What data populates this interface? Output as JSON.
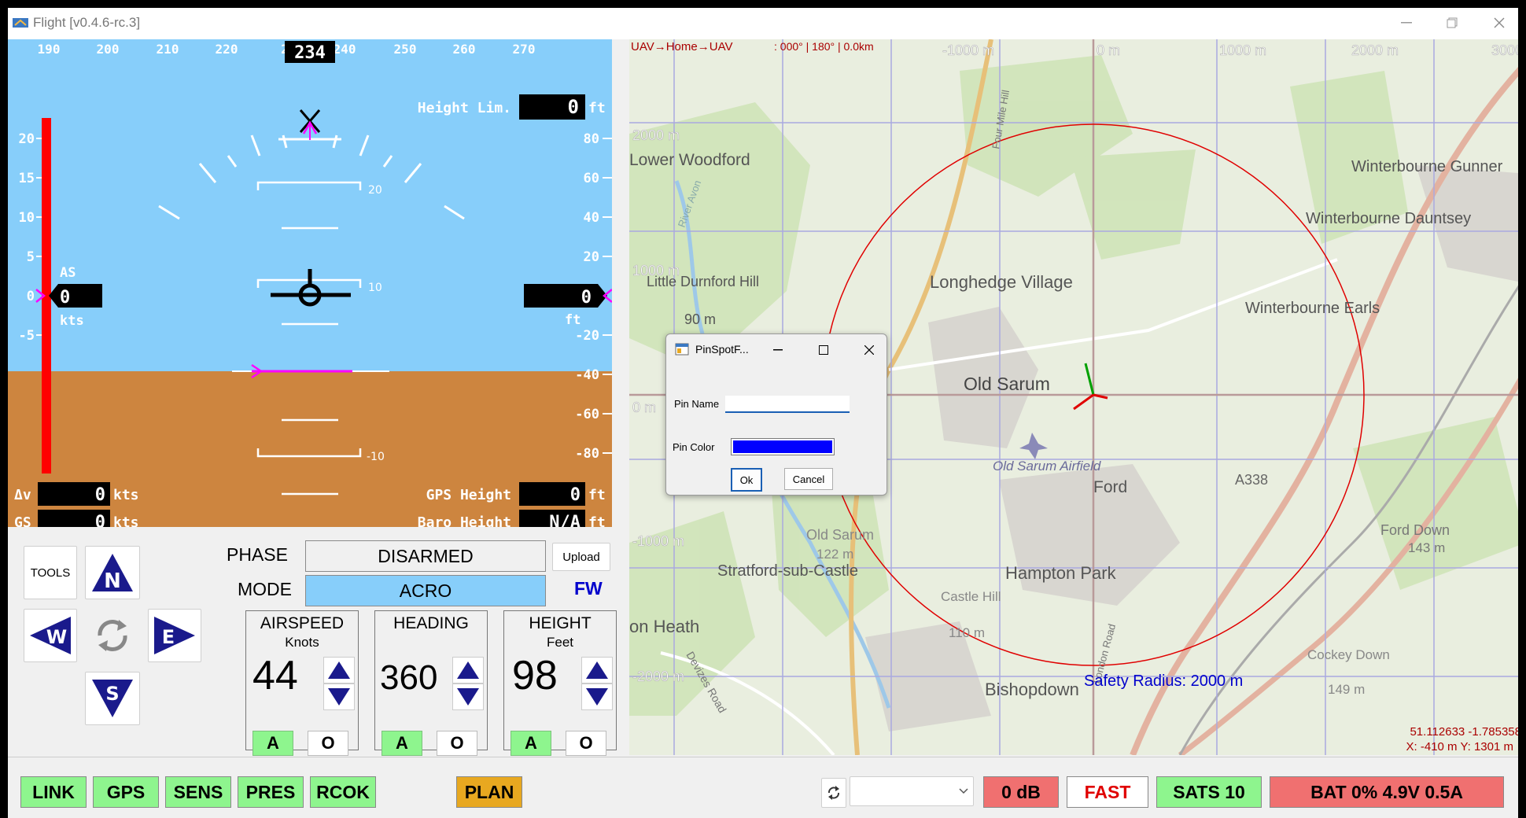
{
  "window": {
    "title": "Flight [v0.4.6-rc.3]"
  },
  "hud": {
    "heading_ticks": [
      "190",
      "200",
      "210",
      "220",
      "2",
      "240",
      "250",
      "260",
      "270"
    ],
    "heading_value": "234",
    "airspeed_ticks": [
      "20",
      "15",
      "10",
      "5",
      "0",
      "-5"
    ],
    "height_ticks": [
      "80",
      "60",
      "40",
      "20",
      "0",
      "-20",
      "-40",
      "-60",
      "-80"
    ],
    "pitch_labels": [
      "20",
      "10",
      "-10"
    ],
    "height_limit_label": "Height Lim.",
    "height_limit_value": "0",
    "height_limit_unit": "ft",
    "as_label": "AS",
    "as_value": "0",
    "as_unit": "kts",
    "alt_value": "0",
    "alt_unit": "ft",
    "dv_label": "Δv",
    "dv_value": "0",
    "dv_unit": "kts",
    "gs_label": "GS",
    "gs_value": "0",
    "gs_unit": "kts",
    "gps_height_label": "GPS Height",
    "gps_height_value": "0",
    "gps_height_unit": "ft",
    "baro_height_label": "Baro Height",
    "baro_height_value": "N/A",
    "baro_height_unit": "ft",
    "sky_color": "#87cefa",
    "ground_color": "#cd853f"
  },
  "controls": {
    "tools_label": "TOOLS",
    "compass": {
      "n": "N",
      "s": "S",
      "e": "E",
      "w": "W"
    },
    "phase_label": "PHASE",
    "phase_value": "DISARMED",
    "upload_label": "Upload",
    "mode_label": "MODE",
    "mode_value": "ACRO",
    "mode_suffix": "FW",
    "airspeed": {
      "title": "AIRSPEED",
      "unit": "Knots",
      "value": "44",
      "a": "A",
      "o": "O"
    },
    "heading": {
      "title": "HEADING",
      "unit": "",
      "value": "360",
      "a": "A",
      "o": "O"
    },
    "height": {
      "title": "HEIGHT",
      "unit": "Feet",
      "value": "98",
      "a": "A",
      "o": "O"
    }
  },
  "map": {
    "header_route": "UAV→Home→UAV",
    "header_info": ": 000° | 180° | 0.0km",
    "grid_x_labels": [
      "-1000 m",
      "0 m",
      "1000 m",
      "2000 m",
      "3000"
    ],
    "grid_y_labels": [
      "2000 m",
      "1000 m",
      "0 m",
      "-1000 m",
      "-2000 m"
    ],
    "places": [
      "Lower Woodford",
      "Little Durnford Hill",
      "90 m",
      "Longhedge Village",
      "Old Sarum",
      "Old Sarum Airfield",
      "Ford",
      "Winterbourne Gunner",
      "Winterbourne Dauntsey",
      "Winterbourne Earls",
      "A338",
      "Ford Down",
      "143 m",
      "Old Sarum",
      "122 m",
      "Stratford-sub-Castle",
      "Hampton Park",
      "Castle Hill",
      "110 m",
      "Bishopdown",
      "Cockey Down",
      "149 m",
      "on Heath",
      "Devizes Road",
      "Four Mile Hill",
      "River Avon",
      "London Road"
    ],
    "safety_radius": "Safety Radius: 2000 m",
    "coords": "51.112633 -1.785358",
    "xy": "X: -410 m Y: 1301 m"
  },
  "dialog": {
    "title": "PinSpotF...",
    "pin_name_label": "Pin Name",
    "pin_name_value": "",
    "pin_color_label": "Pin Color",
    "pin_color": "#0000ff",
    "ok_label": "Ok",
    "cancel_label": "Cancel"
  },
  "status": {
    "link": "LINK",
    "gps": "GPS",
    "sens": "SENS",
    "pres": "PRES",
    "rcok": "RCOK",
    "plan": "PLAN",
    "signal": "0 dB",
    "speed": "FAST",
    "sats": "SATS 10",
    "battery": "BAT 0% 4.9V 0.5A"
  }
}
